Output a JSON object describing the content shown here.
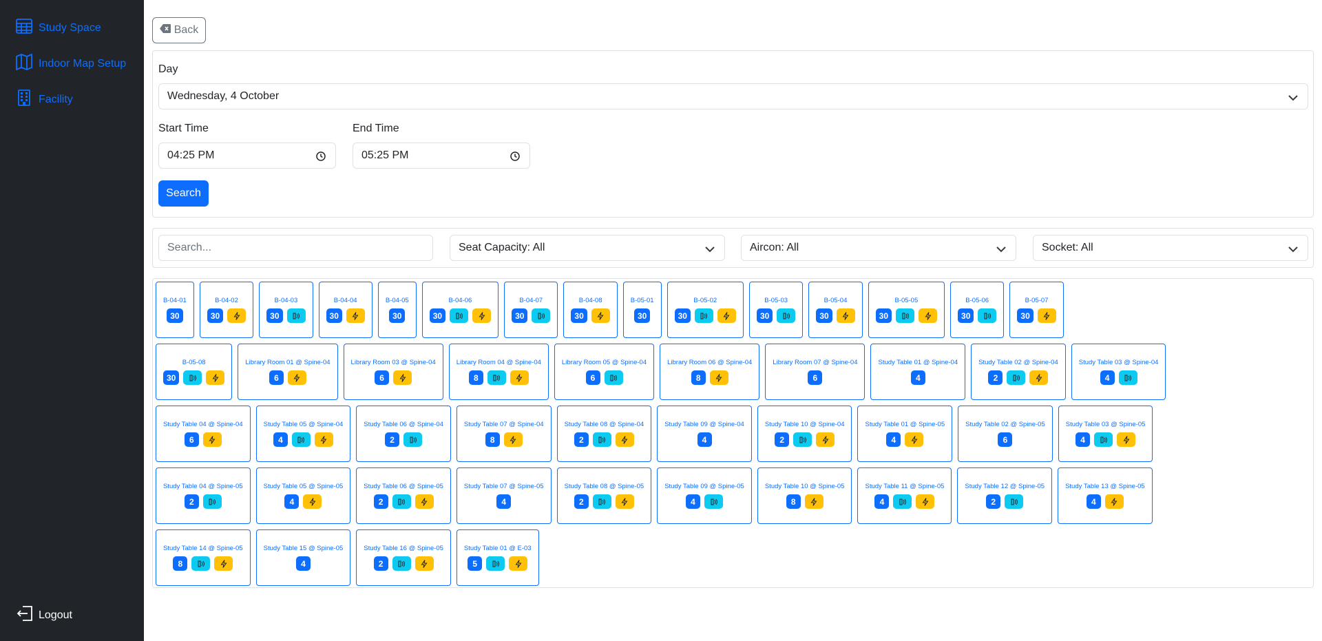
{
  "sidebar": {
    "items": [
      {
        "label": "Study Space",
        "icon": "table-icon"
      },
      {
        "label": "Indoor Map Setup",
        "icon": "map-icon"
      },
      {
        "label": "Facility",
        "icon": "building-icon"
      }
    ],
    "logout_label": "Logout"
  },
  "back_label": "Back",
  "form": {
    "day_label": "Day",
    "day_value": "Wednesday, 4 October",
    "start_label": "Start Time",
    "start_value": "04:25 PM",
    "end_label": "End Time",
    "end_value": "05:25 PM",
    "search_label": "Search"
  },
  "filters": {
    "search_placeholder": "Search...",
    "seat_capacity": "Seat Capacity: All",
    "aircon": "Aircon: All",
    "socket": "Socket: All"
  },
  "colors": {
    "primary": "#0d6efd",
    "aircon": "#0dcaf0",
    "socket": "#ffc107",
    "sidebar": "#212529"
  },
  "spaces": [
    [
      {
        "name": "B-04-01",
        "cap": "30",
        "air": false,
        "sock": false
      },
      {
        "name": "B-04-02",
        "cap": "30",
        "air": false,
        "sock": true
      },
      {
        "name": "B-04-03",
        "cap": "30",
        "air": true,
        "sock": false
      },
      {
        "name": "B-04-04",
        "cap": "30",
        "air": false,
        "sock": true
      },
      {
        "name": "B-04-05",
        "cap": "30",
        "air": false,
        "sock": false
      },
      {
        "name": "B-04-06",
        "cap": "30",
        "air": true,
        "sock": true
      },
      {
        "name": "B-04-07",
        "cap": "30",
        "air": true,
        "sock": false
      },
      {
        "name": "B-04-08",
        "cap": "30",
        "air": false,
        "sock": true
      },
      {
        "name": "B-05-01",
        "cap": "30",
        "air": false,
        "sock": false
      },
      {
        "name": "B-05-02",
        "cap": "30",
        "air": true,
        "sock": true
      },
      {
        "name": "B-05-03",
        "cap": "30",
        "air": true,
        "sock": false
      },
      {
        "name": "B-05-04",
        "cap": "30",
        "air": false,
        "sock": true
      },
      {
        "name": "B-05-05",
        "cap": "30",
        "air": true,
        "sock": true
      },
      {
        "name": "B-05-06",
        "cap": "30",
        "air": true,
        "sock": false
      },
      {
        "name": "B-05-07",
        "cap": "30",
        "air": false,
        "sock": true
      }
    ],
    [
      {
        "name": "B-05-08",
        "cap": "30",
        "air": true,
        "sock": true
      },
      {
        "name": "Library Room 01 @ Spine-04",
        "cap": "6",
        "air": false,
        "sock": true
      },
      {
        "name": "Library Room 03 @ Spine-04",
        "cap": "6",
        "air": false,
        "sock": true
      },
      {
        "name": "Library Room 04 @ Spine-04",
        "cap": "8",
        "air": true,
        "sock": true
      },
      {
        "name": "Library Room 05 @ Spine-04",
        "cap": "6",
        "air": true,
        "sock": false
      },
      {
        "name": "Library Room 06 @ Spine-04",
        "cap": "8",
        "air": false,
        "sock": true
      },
      {
        "name": "Library Room 07 @ Spine-04",
        "cap": "6",
        "air": false,
        "sock": false
      },
      {
        "name": "Study Table 01 @ Spine-04",
        "cap": "4",
        "air": false,
        "sock": false
      },
      {
        "name": "Study Table 02 @ Spine-04",
        "cap": "2",
        "air": true,
        "sock": true
      },
      {
        "name": "Study Table 03 @ Spine-04",
        "cap": "4",
        "air": true,
        "sock": false
      }
    ],
    [
      {
        "name": "Study Table 04 @ Spine-04",
        "cap": "6",
        "air": false,
        "sock": true
      },
      {
        "name": "Study Table 05 @ Spine-04",
        "cap": "4",
        "air": true,
        "sock": true
      },
      {
        "name": "Study Table 06 @ Spine-04",
        "cap": "2",
        "air": true,
        "sock": false
      },
      {
        "name": "Study Table 07 @ Spine-04",
        "cap": "8",
        "air": false,
        "sock": true
      },
      {
        "name": "Study Table 08 @ Spine-04",
        "cap": "2",
        "air": true,
        "sock": true
      },
      {
        "name": "Study Table 09 @ Spine-04",
        "cap": "4",
        "air": false,
        "sock": false
      },
      {
        "name": "Study Table 10 @ Spine-04",
        "cap": "2",
        "air": true,
        "sock": true
      },
      {
        "name": "Study Table 01 @ Spine-05",
        "cap": "4",
        "air": false,
        "sock": true
      },
      {
        "name": "Study Table 02 @ Spine-05",
        "cap": "6",
        "air": false,
        "sock": false
      },
      {
        "name": "Study Table 03 @ Spine-05",
        "cap": "4",
        "air": true,
        "sock": true
      }
    ],
    [
      {
        "name": "Study Table 04 @ Spine-05",
        "cap": "2",
        "air": true,
        "sock": false
      },
      {
        "name": "Study Table 05 @ Spine-05",
        "cap": "4",
        "air": false,
        "sock": true
      },
      {
        "name": "Study Table 06 @ Spine-05",
        "cap": "2",
        "air": true,
        "sock": true
      },
      {
        "name": "Study Table 07 @ Spine-05",
        "cap": "4",
        "air": false,
        "sock": false
      },
      {
        "name": "Study Table 08 @ Spine-05",
        "cap": "2",
        "air": true,
        "sock": true
      },
      {
        "name": "Study Table 09 @ Spine-05",
        "cap": "4",
        "air": true,
        "sock": false
      },
      {
        "name": "Study Table 10 @ Spine-05",
        "cap": "8",
        "air": false,
        "sock": true
      },
      {
        "name": "Study Table 11 @ Spine-05",
        "cap": "4",
        "air": true,
        "sock": true
      },
      {
        "name": "Study Table 12 @ Spine-05",
        "cap": "2",
        "air": true,
        "sock": false
      },
      {
        "name": "Study Table 13 @ Spine-05",
        "cap": "4",
        "air": false,
        "sock": true
      }
    ],
    [
      {
        "name": "Study Table 14 @ Spine-05",
        "cap": "8",
        "air": true,
        "sock": true
      },
      {
        "name": "Study Table 15 @ Spine-05",
        "cap": "4",
        "air": false,
        "sock": false
      },
      {
        "name": "Study Table 16 @ Spine-05",
        "cap": "2",
        "air": true,
        "sock": true
      },
      {
        "name": "Study Table 01 @ E-03",
        "cap": "5",
        "air": true,
        "sock": true
      }
    ]
  ]
}
